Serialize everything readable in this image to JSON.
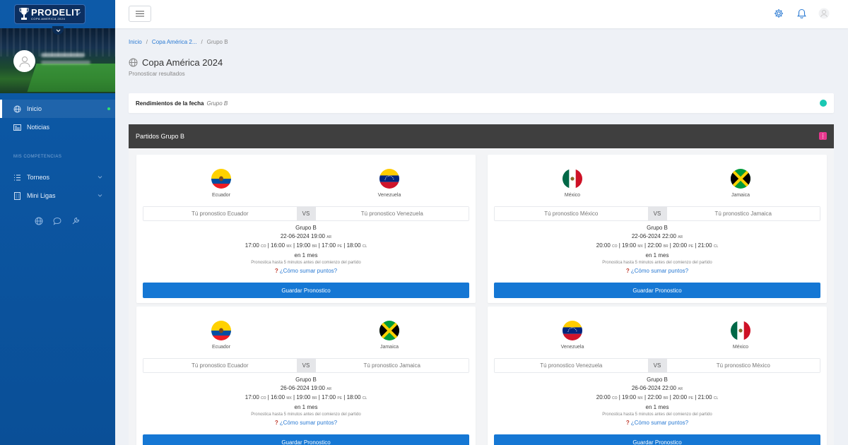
{
  "brand": {
    "logo_main": "PRODELIT",
    "logo_sub": "COPA AMERICA 2024"
  },
  "sidebar": {
    "items": [
      {
        "label": "Inicio",
        "icon": "globe-icon"
      },
      {
        "label": "Noticias",
        "icon": "newspaper-icon"
      }
    ],
    "section_label": "MIS COMPETENCIAS",
    "competitions": [
      {
        "label": "Torneos",
        "icon": "list-icon"
      },
      {
        "label": "Mini Ligas",
        "icon": "building-icon"
      }
    ],
    "bottom_icons": [
      "globe-icon",
      "chat-icon",
      "wrench-icon"
    ]
  },
  "topbar": {
    "icons": [
      "gear-icon",
      "bell-icon",
      "user-icon"
    ]
  },
  "breadcrumb": {
    "home": "Inicio",
    "parent": "Copa América 2...",
    "current": "Grupo B"
  },
  "page": {
    "title": "Copa América 2024",
    "subtitle": "Pronosticar resultados"
  },
  "performance": {
    "label": "Rendimientos de la fecha",
    "group": "Grupo B"
  },
  "matches_header": "Partidos Grupo B",
  "matches": [
    {
      "home": "Ecuador",
      "away": "Venezuela",
      "home_placeholder": "Tú pronostico Ecuador",
      "away_placeholder": "Tú pronostico Venezuela",
      "vs": "VS",
      "group": "Grupo B",
      "date": "22-06-2024 19:00",
      "date_tz": "AR",
      "t1": "17:00",
      "z1": "CO",
      "t2": "16:00",
      "z2": "MX",
      "t3": "19:00",
      "z3": "BR",
      "t4": "17:00",
      "z4": "PE",
      "t5": "18:00",
      "z5": "CL",
      "relative": "en 1 mes",
      "note": "Pronostica hasta 5 minutos antes del comienzo del partido",
      "how": "¿Cómo sumar puntos?",
      "button": "Guardar Pronostico"
    },
    {
      "home": "México",
      "away": "Jamaica",
      "home_placeholder": "Tú pronostico México",
      "away_placeholder": "Tú pronostico Jamaica",
      "vs": "VS",
      "group": "Grupo B",
      "date": "22-06-2024 22:00",
      "date_tz": "AR",
      "t1": "20:00",
      "z1": "CO",
      "t2": "19:00",
      "z2": "MX",
      "t3": "22:00",
      "z3": "BR",
      "t4": "20:00",
      "z4": "PE",
      "t5": "21:00",
      "z5": "CL",
      "relative": "en 1 mes",
      "note": "Pronostica hasta 5 minutos antes del comienzo del partido",
      "how": "¿Cómo sumar puntos?",
      "button": "Guardar Pronostico"
    },
    {
      "home": "Ecuador",
      "away": "Jamaica",
      "home_placeholder": "Tú pronostico Ecuador",
      "away_placeholder": "Tú pronostico Jamaica",
      "vs": "VS",
      "group": "Grupo B",
      "date": "26-06-2024 19:00",
      "date_tz": "AR",
      "t1": "17:00",
      "z1": "CO",
      "t2": "16:00",
      "z2": "MX",
      "t3": "19:00",
      "z3": "BR",
      "t4": "17:00",
      "z4": "PE",
      "t5": "18:00",
      "z5": "CL",
      "relative": "en 1 mes",
      "note": "Pronostica hasta 5 minutos antes del comienzo del partido",
      "how": "¿Cómo sumar puntos?",
      "button": "Guardar Pronostico"
    },
    {
      "home": "Venezuela",
      "away": "México",
      "home_placeholder": "Tú pronostico Venezuela",
      "away_placeholder": "Tú pronostico México",
      "vs": "VS",
      "group": "Grupo B",
      "date": "26-06-2024 22:00",
      "date_tz": "AR",
      "t1": "20:00",
      "z1": "CO",
      "t2": "19:00",
      "z2": "MX",
      "t3": "22:00",
      "z3": "BR",
      "t4": "20:00",
      "z4": "PE",
      "t5": "21:00",
      "z5": "CL",
      "relative": "en 1 mes",
      "note": "Pronostica hasta 5 minutos antes del comienzo del partido",
      "how": "¿Cómo sumar puntos?",
      "button": "Guardar Pronostico"
    }
  ],
  "colors": {
    "sidebar": "#0d5aa8",
    "primary": "#1577d4",
    "header_dark": "#3f3f3f",
    "teal": "#19c8b3",
    "pink": "#e8388f"
  }
}
